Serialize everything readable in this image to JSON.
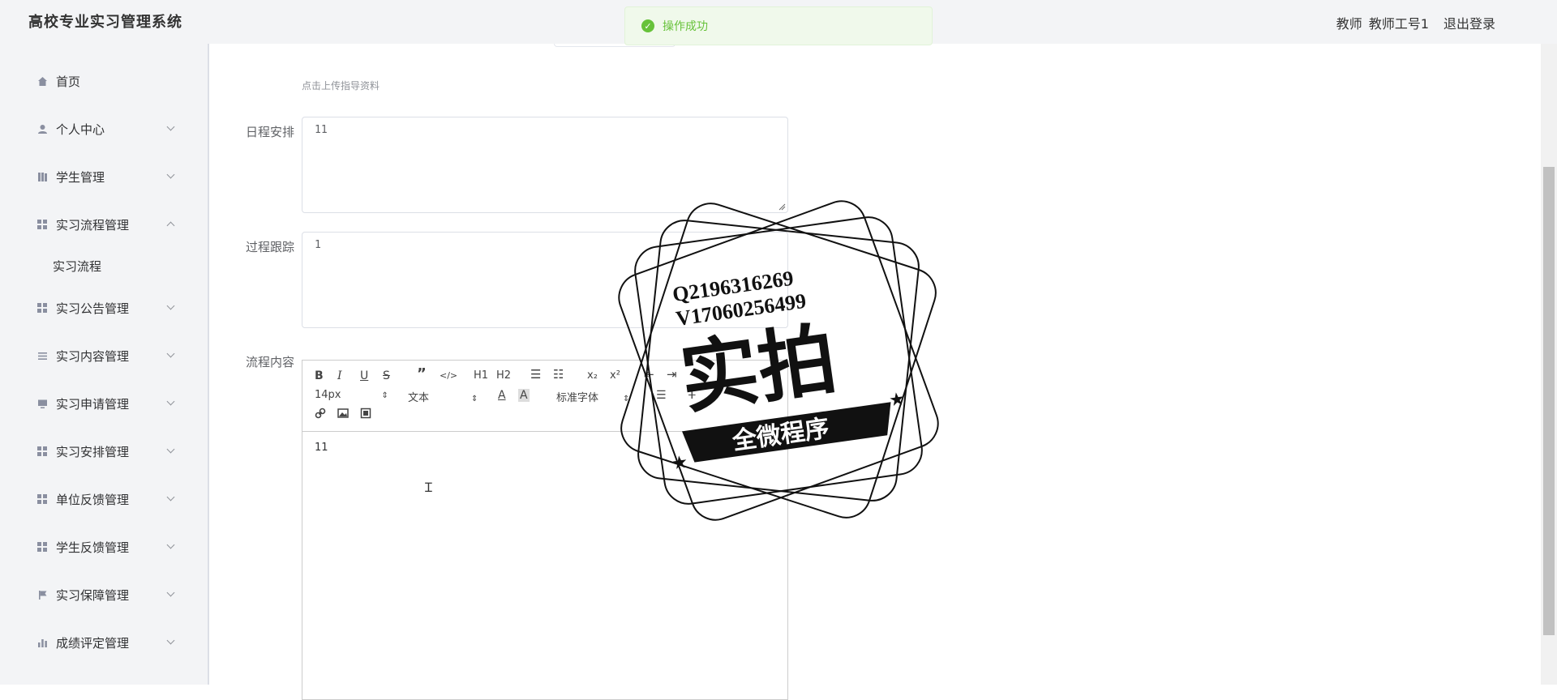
{
  "header": {
    "title": "高校专业实习管理系统",
    "role": "教师",
    "account": "教师工号1",
    "logout_label": "退出登录"
  },
  "toast": {
    "message": "操作成功",
    "icon": "check-circle-icon",
    "color": "#67c23a"
  },
  "sidebar": {
    "items": [
      {
        "label": "首页",
        "icon": "home-icon"
      },
      {
        "label": "个人中心",
        "icon": "user-icon"
      },
      {
        "label": "学生管理",
        "icon": "book-icon"
      },
      {
        "label": "实习流程管理",
        "icon": "grid-icon"
      },
      {
        "label": "实习公告管理",
        "icon": "grid-icon"
      },
      {
        "label": "实习内容管理",
        "icon": "list-icon"
      },
      {
        "label": "实习申请管理",
        "icon": "monitor-icon"
      },
      {
        "label": "实习安排管理",
        "icon": "grid-icon"
      },
      {
        "label": "单位反馈管理",
        "icon": "grid-icon"
      },
      {
        "label": "学生反馈管理",
        "icon": "grid-icon"
      },
      {
        "label": "实习保障管理",
        "icon": "flag-icon"
      },
      {
        "label": "成绩评定管理",
        "icon": "bar-chart-icon"
      }
    ],
    "sub_item": "实习流程"
  },
  "form": {
    "upload_hint": "点击上传指导资料",
    "schedule_label": "日程安排",
    "schedule_value": "11",
    "tracking_label": "过程跟踪",
    "tracking_value": "1",
    "content_label": "流程内容",
    "content_value": "11"
  },
  "editor": {
    "font_size": "14px",
    "block_type": "文本",
    "font_family": "标准字体",
    "h1": "H1",
    "h2": "H2"
  },
  "watermark": {
    "line1": "Q2196316269",
    "line2": "V17060256499",
    "main": "实拍",
    "banner": "全微程序"
  }
}
